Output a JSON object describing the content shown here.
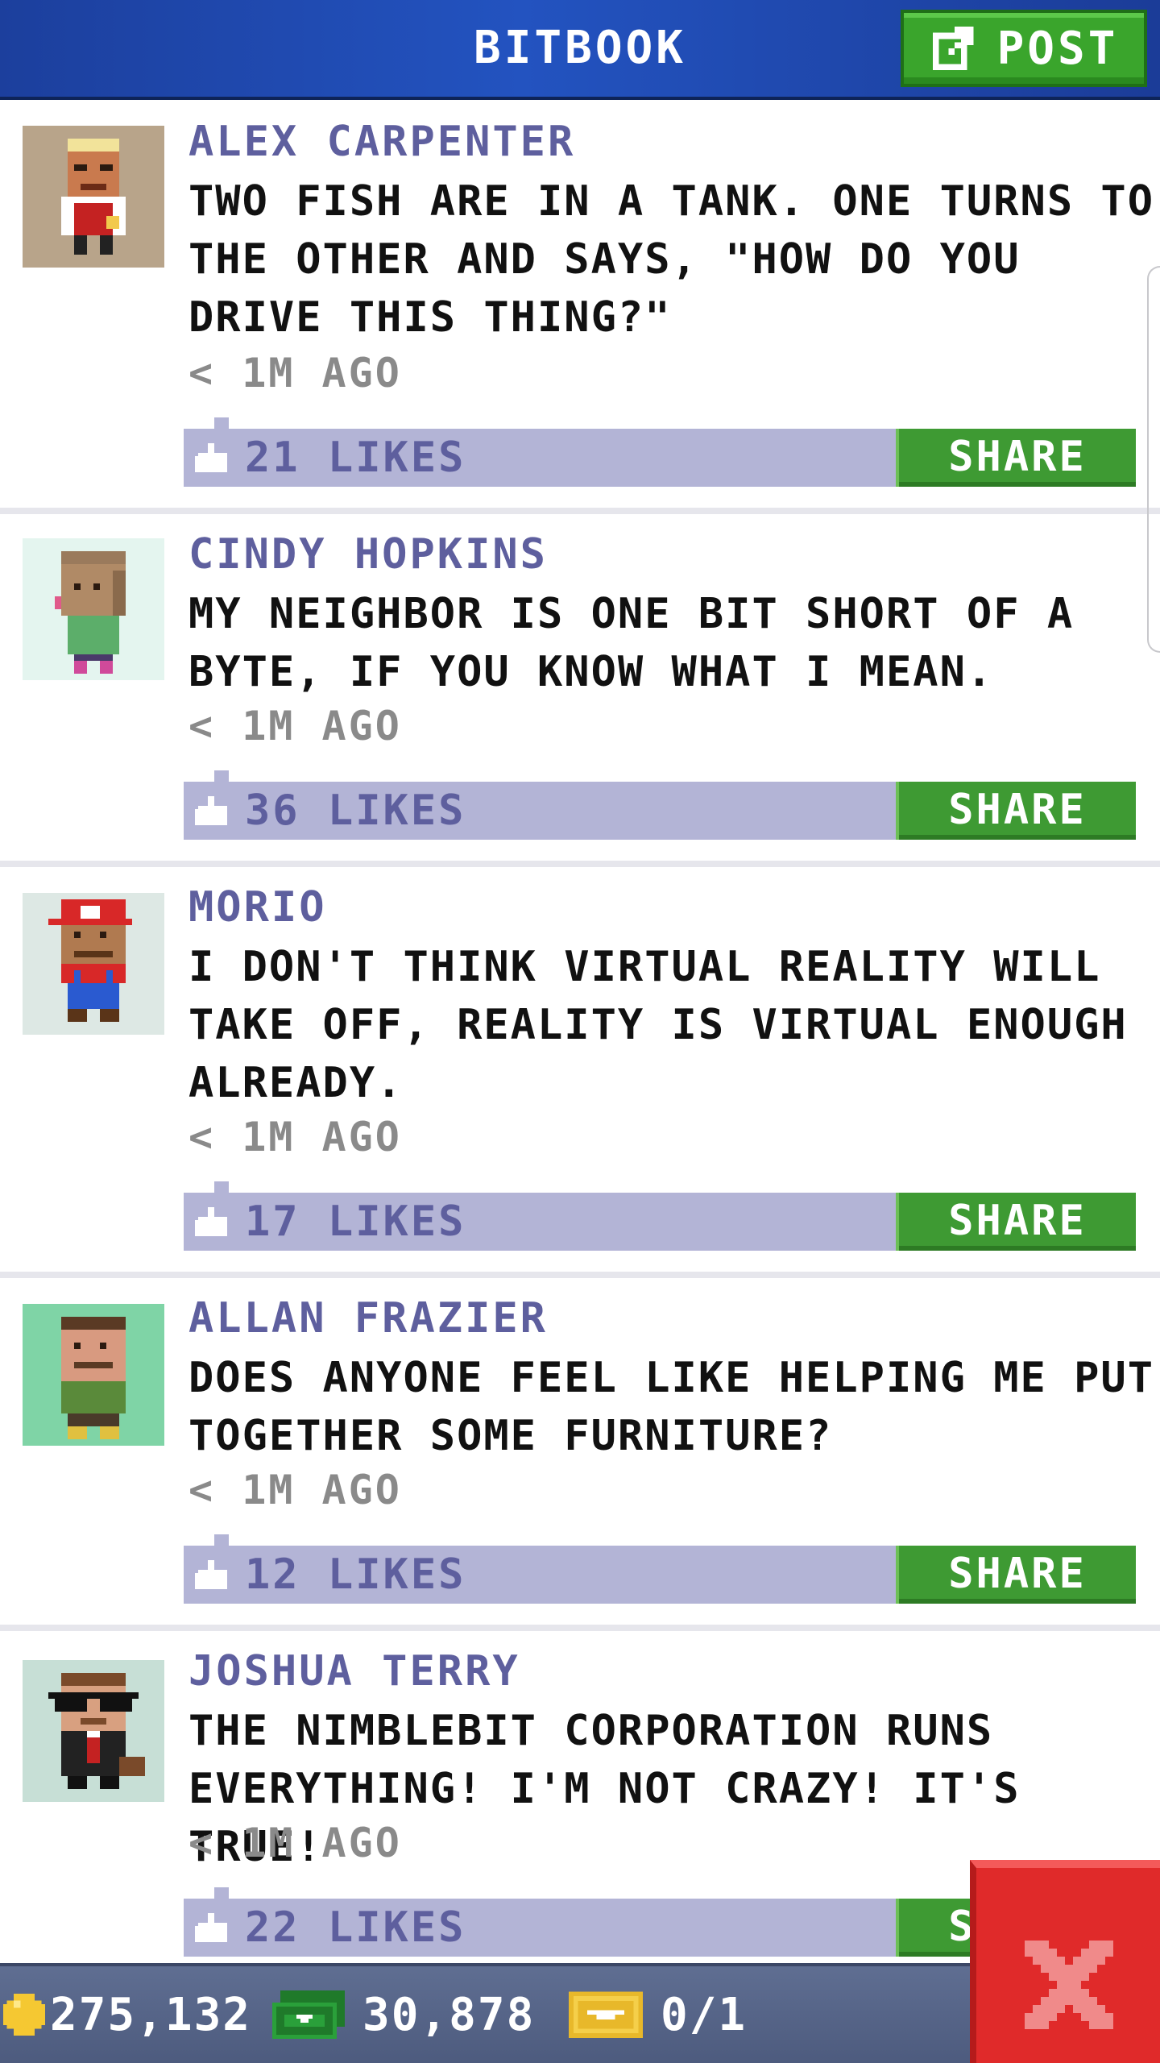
{
  "header": {
    "title": "BITBOOK",
    "post_button_label": "POST"
  },
  "posts": [
    {
      "author": "ALEX CARPENTER",
      "message": "TWO FISH ARE IN A TANK. ONE TURNS TO THE OTHER AND SAYS, \"HOW DO YOU DRIVE THIS THING?\"",
      "time": "< 1M AGO",
      "likes": "21 LIKES",
      "share_label": "SHARE",
      "avatar_bg": "#b8a48a"
    },
    {
      "author": "CINDY HOPKINS",
      "message": "MY NEIGHBOR IS ONE BIT SHORT OF A BYTE, IF YOU KNOW WHAT I MEAN.",
      "time": "< 1M AGO",
      "likes": "36 LIKES",
      "share_label": "SHARE",
      "avatar_bg": "#e4f5ef"
    },
    {
      "author": "MORIO",
      "message": "I DON'T THINK VIRTUAL REALITY WILL TAKE OFF, REALITY IS VIRTUAL ENOUGH ALREADY.",
      "time": "< 1M AGO",
      "likes": "17 LIKES",
      "share_label": "SHARE",
      "avatar_bg": "#dde8e4"
    },
    {
      "author": "ALLAN FRAZIER",
      "message": "DOES ANYONE FEEL LIKE HELPING ME PUT TOGETHER SOME FURNITURE?",
      "time": "< 1M AGO",
      "likes": "12 LIKES",
      "share_label": "SHARE",
      "avatar_bg": "#7fd4a6"
    },
    {
      "author": "JOSHUA TERRY",
      "message": "THE NIMBLEBIT CORPORATION RUNS EVERYTHING! I'M NOT CRAZY! IT'S TRUE!",
      "time": "< 1M AGO",
      "likes": "22 LIKES",
      "share_label": "SHARE",
      "avatar_bg": "#c7dfd6"
    }
  ],
  "status_bar": {
    "coins": "275,132",
    "bux": "30,878",
    "tickets": "0/1"
  },
  "colors": {
    "header_blue": "#2353c0",
    "post_green": "#3aa52c",
    "author_purple": "#5e5f9e",
    "likes_bar": "#b3b4d6",
    "share_green": "#3e9a33",
    "close_red": "#e02a2a"
  },
  "icons": {
    "post": "compose-icon",
    "likes": "thumbs-up-icon",
    "coins": "coin-icon",
    "bux": "bux-icon",
    "tickets": "ticket-icon",
    "close": "close-icon"
  }
}
